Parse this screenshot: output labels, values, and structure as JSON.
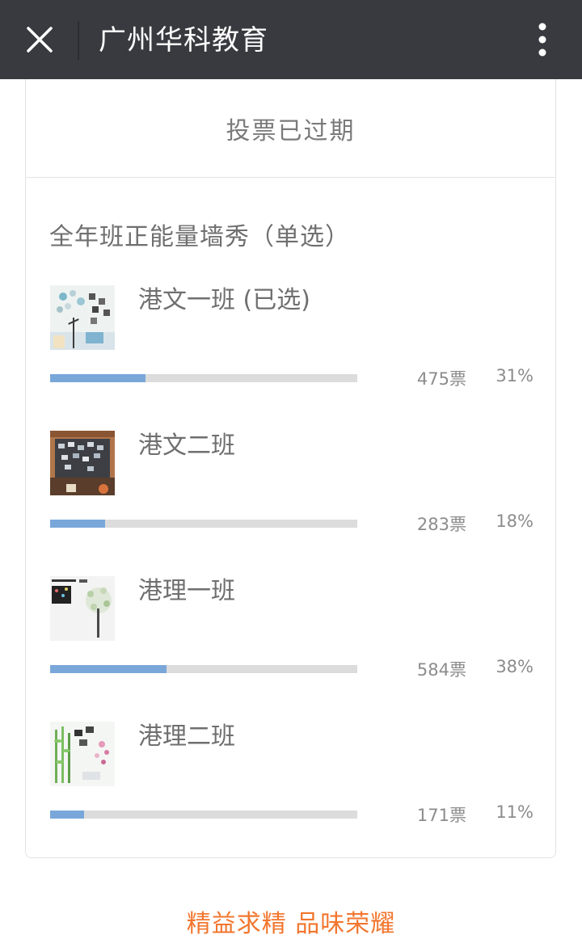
{
  "header": {
    "title": "广州华科教育",
    "close_icon": "close-icon",
    "more_icon": "more-vertical-icon"
  },
  "poll": {
    "status": "投票已过期",
    "question": "全年班正能量墙秀（单选）",
    "options": [
      {
        "label": "港文一班 (已选)",
        "votes": "475票",
        "percent": "31%",
        "fraction": 0.31
      },
      {
        "label": "港文二班",
        "votes": "283票",
        "percent": "18%",
        "fraction": 0.18
      },
      {
        "label": "港理一班",
        "votes": "584票",
        "percent": "38%",
        "fraction": 0.38
      },
      {
        "label": "港理二班",
        "votes": "171票",
        "percent": "11%",
        "fraction": 0.11
      }
    ]
  },
  "footer": {
    "slogan": "精益求精  品味荣耀"
  },
  "colors": {
    "topbar": "#393a3f",
    "bar_fill": "#79a7da",
    "bar_track": "#dcdcdc",
    "slogan": "#f2762e"
  }
}
